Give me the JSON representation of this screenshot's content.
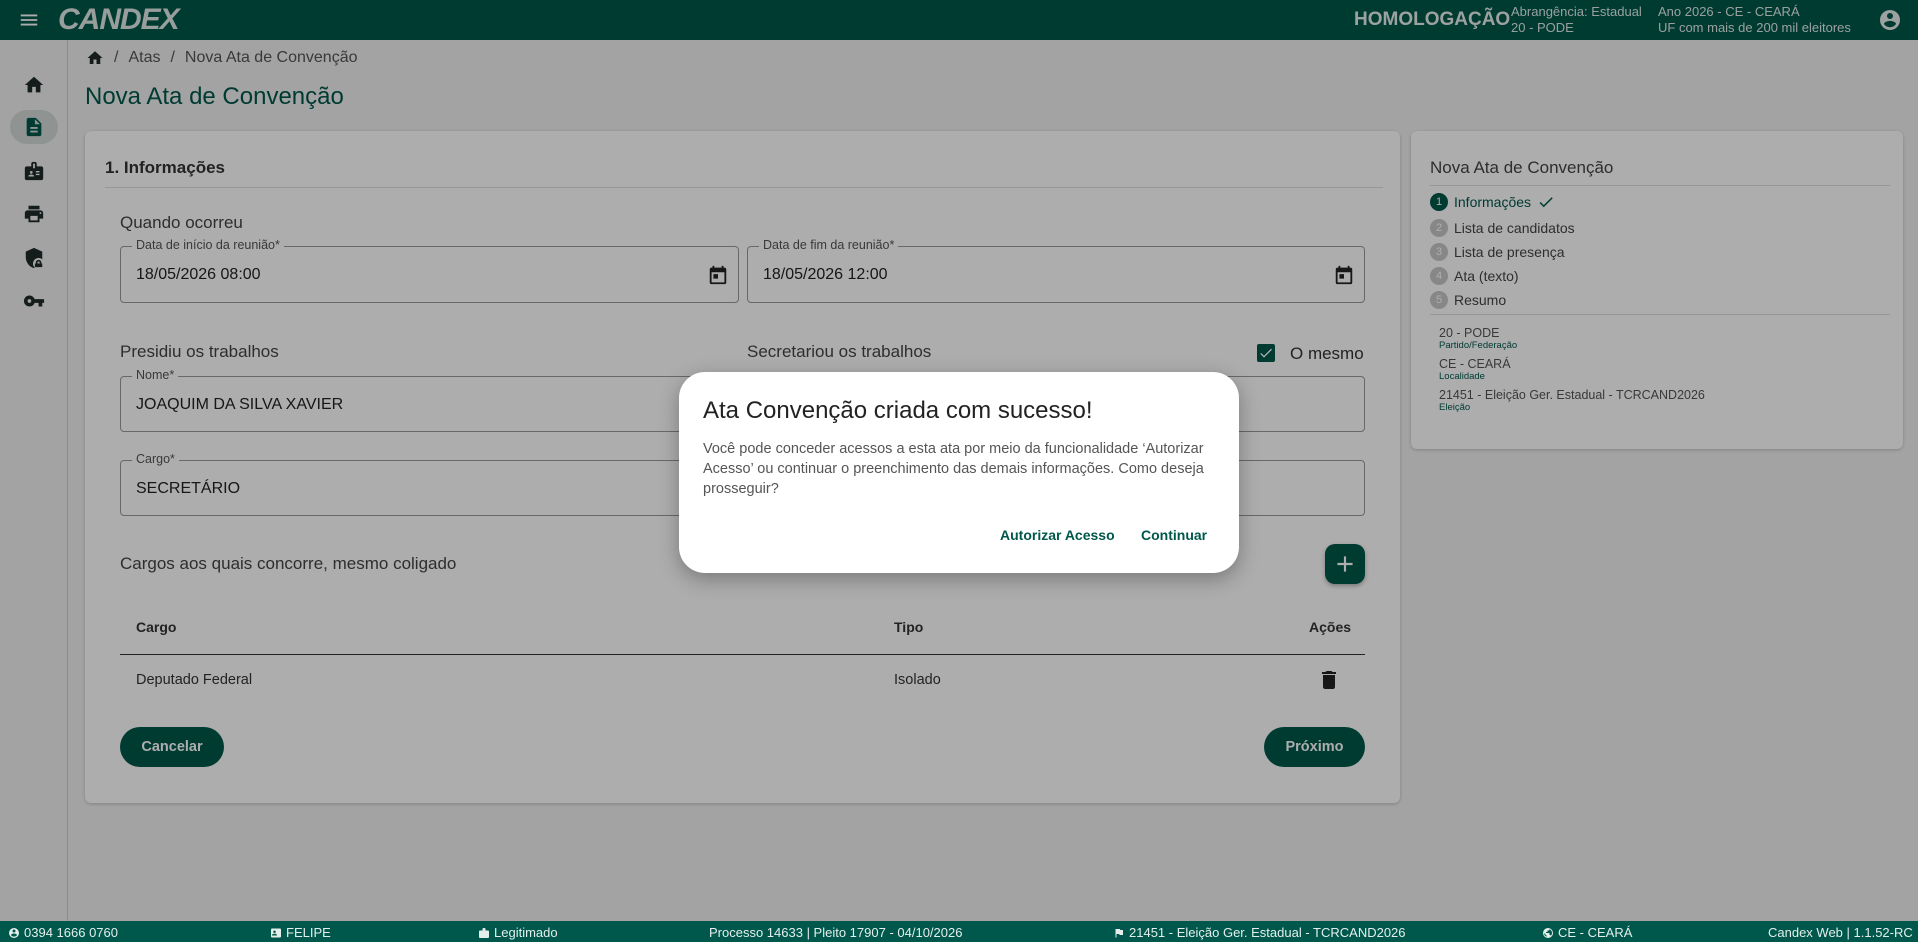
{
  "header": {
    "logo": "CANDEX",
    "environment": "HOMOLOGAÇÃO",
    "abrangencia_line1": "Abrangência: Estadual",
    "abrangencia_line2": "20 - PODE",
    "ano_line1": "Ano 2026 - CE - CEARÁ",
    "ano_line2": "UF com mais de 200 mil eleitores"
  },
  "sidebar": {
    "items": [
      {
        "icon": "home-icon"
      },
      {
        "icon": "document-icon",
        "active": true
      },
      {
        "icon": "badge-icon"
      },
      {
        "icon": "printer-icon"
      },
      {
        "icon": "shield-lock-icon"
      },
      {
        "icon": "key-icon"
      }
    ]
  },
  "breadcrumb": {
    "items": [
      "Atas",
      "Nova Ata de Convenção"
    ],
    "separator": "/"
  },
  "page_title": "Nova Ata de Convenção",
  "form": {
    "section_title": "1. Informações",
    "quando_ocorreu": "Quando ocorreu",
    "data_inicio_label": "Data de início da reunião*",
    "data_inicio_value": "18/05/2026 08:00",
    "data_fim_label": "Data de fim da reunião*",
    "data_fim_value": "18/05/2026 12:00",
    "presidiu": "Presidiu os trabalhos",
    "secretariou": "Secretariou os trabalhos",
    "o_mesmo": "O mesmo",
    "nome_label": "Nome*",
    "nome_value": "JOAQUIM DA SILVA XAVIER",
    "cargo_label": "Cargo*",
    "cargo_value": "SECRETÁRIO",
    "cargos_title": "Cargos aos quais concorre, mesmo coligado",
    "table": {
      "headers": [
        "Cargo",
        "Tipo",
        "Ações"
      ],
      "rows": [
        {
          "cargo": "Deputado Federal",
          "tipo": "Isolado"
        }
      ]
    },
    "cancel_label": "Cancelar",
    "next_label": "Próximo"
  },
  "stepper": {
    "title": "Nova Ata de Convenção",
    "steps": [
      {
        "num": "1",
        "label": "Informações",
        "done": true
      },
      {
        "num": "2",
        "label": "Lista de candidatos"
      },
      {
        "num": "3",
        "label": "Lista de presença"
      },
      {
        "num": "4",
        "label": "Ata (texto)"
      },
      {
        "num": "5",
        "label": "Resumo"
      }
    ],
    "info": [
      {
        "value": "20 - PODE",
        "label": "Partido/Federação"
      },
      {
        "value": "CE - CEARÁ",
        "label": "Localidade"
      },
      {
        "value": "21451 - Eleição Ger. Estadual - TCRCAND2026",
        "label": "Eleição"
      }
    ]
  },
  "dialog": {
    "title": "Ata Convenção criada com sucesso!",
    "text": "Você pode conceder acessos a esta ata por meio da funcionalidade ‘Autorizar Acesso’ ou continuar o preenchimento das demais informações. Como deseja prosseguir?",
    "authorize_label": "Autorizar Acesso",
    "continue_label": "Continuar"
  },
  "statusbar": {
    "phone": "0394 1666 0760",
    "user": "FELIPE",
    "status": "Legitimado",
    "processo": "Processo 14633 | Pleito 17907 - 04/10/2026",
    "eleicao": "21451 - Eleição Ger. Estadual - TCRCAND2026",
    "uf": "CE - CEARÁ",
    "version": "Candex Web | 1.1.52-RC"
  },
  "colors": {
    "primary": "#00574b",
    "background": "#f0f0f0"
  }
}
